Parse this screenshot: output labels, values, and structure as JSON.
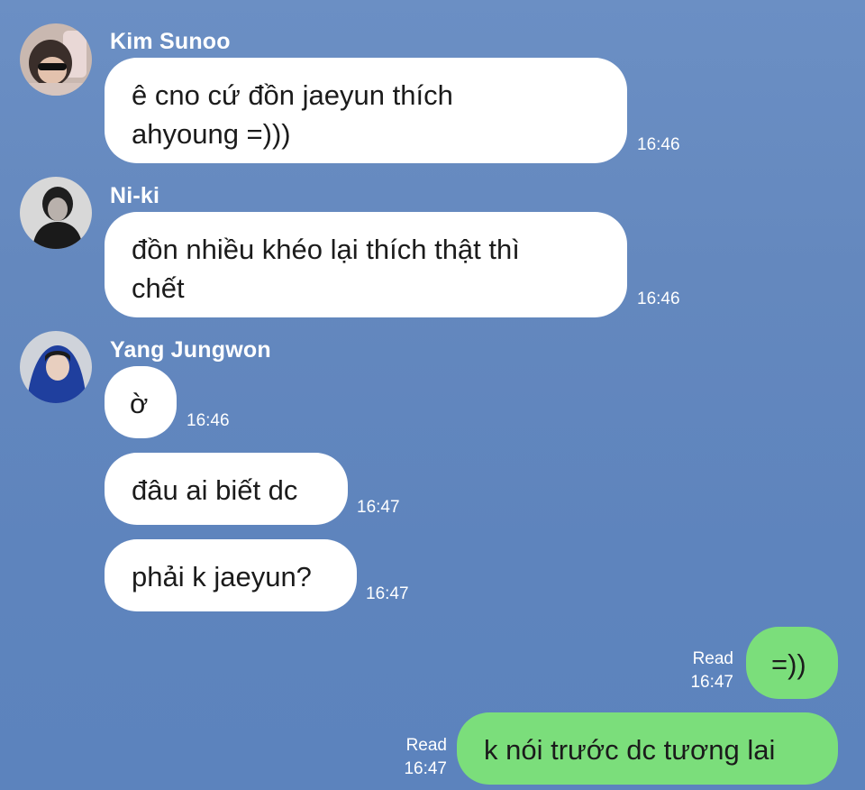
{
  "messages": [
    {
      "sender": "Kim Sunoo",
      "text": "ê cno cứ đồn jaeyun thích\nahyoung =)))",
      "time": "16:46"
    },
    {
      "sender": "Ni-ki",
      "text": "đồn nhiều khéo lại thích thật thì\nchết",
      "time": "16:46"
    },
    {
      "sender": "Yang Jungwon",
      "text": "ờ",
      "time": "16:46"
    },
    {
      "sender": "",
      "text": "đâu ai biết dc",
      "time": "16:47"
    },
    {
      "sender": "",
      "text": "phải k jaeyun?",
      "time": "16:47"
    }
  ],
  "outgoing": [
    {
      "text": "=))",
      "read": "Read",
      "time": "16:47"
    },
    {
      "text": "k nói trước dc tương lai",
      "read": "Read",
      "time": "16:47"
    }
  ],
  "colors": {
    "background": "#6488be",
    "incoming_bubble": "#ffffff",
    "outgoing_bubble": "#7bde7b"
  }
}
